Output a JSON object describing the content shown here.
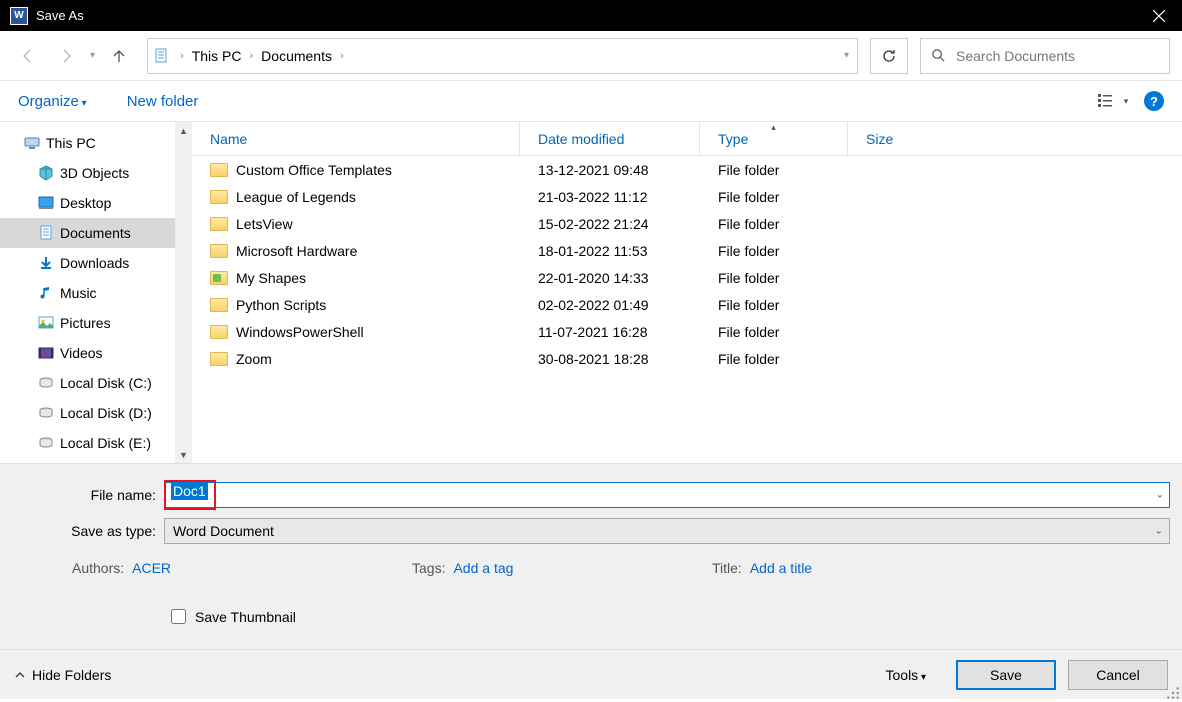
{
  "window": {
    "title": "Save As"
  },
  "breadcrumb": {
    "root_sep": "›",
    "pc": "This PC",
    "folder": "Documents"
  },
  "nav": {
    "refresh_tip": "Refresh"
  },
  "search": {
    "placeholder": "Search Documents"
  },
  "toolbar": {
    "organize": "Organize",
    "new_folder": "New folder"
  },
  "sidebar": {
    "items": [
      {
        "label": "This PC",
        "kind": "pc"
      },
      {
        "label": "3D Objects",
        "kind": "3d"
      },
      {
        "label": "Desktop",
        "kind": "desktop"
      },
      {
        "label": "Documents",
        "kind": "documents",
        "selected": true
      },
      {
        "label": "Downloads",
        "kind": "downloads"
      },
      {
        "label": "Music",
        "kind": "music"
      },
      {
        "label": "Pictures",
        "kind": "pictures"
      },
      {
        "label": "Videos",
        "kind": "videos"
      },
      {
        "label": "Local Disk (C:)",
        "kind": "disk"
      },
      {
        "label": "Local Disk (D:)",
        "kind": "disk"
      },
      {
        "label": "Local Disk (E:)",
        "kind": "disk"
      }
    ]
  },
  "columns": {
    "name": "Name",
    "date": "Date modified",
    "type": "Type",
    "size": "Size"
  },
  "files": [
    {
      "name": "Custom Office Templates",
      "date": "13-12-2021 09:48",
      "type": "File folder",
      "special": false
    },
    {
      "name": "League of Legends",
      "date": "21-03-2022 11:12",
      "type": "File folder",
      "special": false
    },
    {
      "name": "LetsView",
      "date": "15-02-2022 21:24",
      "type": "File folder",
      "special": false
    },
    {
      "name": "Microsoft Hardware",
      "date": "18-01-2022 11:53",
      "type": "File folder",
      "special": false
    },
    {
      "name": "My Shapes",
      "date": "22-01-2020 14:33",
      "type": "File folder",
      "special": true
    },
    {
      "name": "Python Scripts",
      "date": "02-02-2022 01:49",
      "type": "File folder",
      "special": false
    },
    {
      "name": "WindowsPowerShell",
      "date": "11-07-2021 16:28",
      "type": "File folder",
      "special": false
    },
    {
      "name": "Zoom",
      "date": "30-08-2021 18:28",
      "type": "File folder",
      "special": false
    }
  ],
  "form": {
    "filename_label": "File name:",
    "filename_value": "Doc1",
    "savetype_label": "Save as type:",
    "savetype_value": "Word Document",
    "authors_label": "Authors:",
    "authors_value": "ACER",
    "tags_label": "Tags:",
    "tags_value": "Add a tag",
    "title_label": "Title:",
    "title_value": "Add a title",
    "save_thumbnail": "Save Thumbnail"
  },
  "footer": {
    "hide_folders": "Hide Folders",
    "tools": "Tools",
    "save": "Save",
    "cancel": "Cancel"
  }
}
